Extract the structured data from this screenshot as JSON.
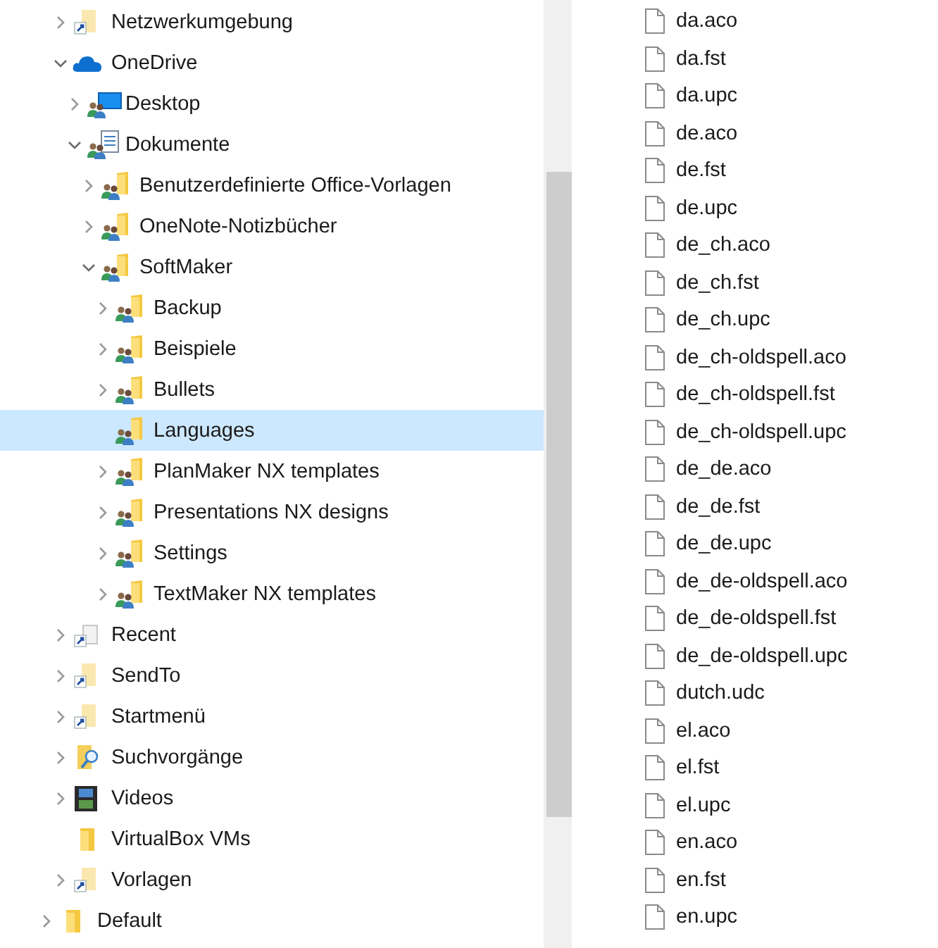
{
  "navigation_pane": {
    "items": [
      {
        "label": "Netzwerkumgebung",
        "kind": "shortcut-folder",
        "has_children": true,
        "expanded": false,
        "selected": false
      },
      {
        "label": "OneDrive",
        "kind": "cloud",
        "has_children": true,
        "expanded": true,
        "selected": false,
        "children": [
          {
            "label": "Desktop",
            "kind": "shared-desktop",
            "has_children": true,
            "expanded": false,
            "selected": false
          },
          {
            "label": "Dokumente",
            "kind": "shared-documents",
            "has_children": true,
            "expanded": true,
            "selected": false,
            "children": [
              {
                "label": "Benutzerdefinierte Office-Vorlagen",
                "kind": "shared-folder",
                "has_children": true,
                "expanded": false,
                "selected": false
              },
              {
                "label": "OneNote-Notizbücher",
                "kind": "shared-folder",
                "has_children": true,
                "expanded": false,
                "selected": false
              },
              {
                "label": "SoftMaker",
                "kind": "shared-folder",
                "has_children": true,
                "expanded": true,
                "selected": false,
                "children": [
                  {
                    "label": "Backup",
                    "kind": "shared-folder",
                    "has_children": true,
                    "expanded": false,
                    "selected": false
                  },
                  {
                    "label": "Beispiele",
                    "kind": "shared-folder",
                    "has_children": true,
                    "expanded": false,
                    "selected": false
                  },
                  {
                    "label": "Bullets",
                    "kind": "shared-folder",
                    "has_children": true,
                    "expanded": false,
                    "selected": false
                  },
                  {
                    "label": "Languages",
                    "kind": "shared-folder",
                    "has_children": false,
                    "selected": true
                  },
                  {
                    "label": "PlanMaker NX templates",
                    "kind": "shared-folder",
                    "has_children": true,
                    "expanded": false,
                    "selected": false
                  },
                  {
                    "label": "Presentations NX designs",
                    "kind": "shared-folder",
                    "has_children": true,
                    "expanded": false,
                    "selected": false
                  },
                  {
                    "label": "Settings",
                    "kind": "shared-folder",
                    "has_children": true,
                    "expanded": false,
                    "selected": false
                  },
                  {
                    "label": "TextMaker NX templates",
                    "kind": "shared-folder",
                    "has_children": true,
                    "expanded": false,
                    "selected": false
                  }
                ]
              }
            ]
          }
        ]
      },
      {
        "label": "Recent",
        "kind": "shortcut-file",
        "has_children": true,
        "expanded": false,
        "selected": false
      },
      {
        "label": "SendTo",
        "kind": "shortcut-folder",
        "has_children": true,
        "expanded": false,
        "selected": false
      },
      {
        "label": "Startmenü",
        "kind": "shortcut-folder",
        "has_children": true,
        "expanded": false,
        "selected": false
      },
      {
        "label": "Suchvorgänge",
        "kind": "search-folder",
        "has_children": true,
        "expanded": false,
        "selected": false
      },
      {
        "label": "Videos",
        "kind": "video-folder",
        "has_children": true,
        "expanded": false,
        "selected": false
      },
      {
        "label": "VirtualBox VMs",
        "kind": "folder",
        "has_children": false,
        "selected": false
      },
      {
        "label": "Vorlagen",
        "kind": "shortcut-folder",
        "has_children": true,
        "expanded": false,
        "selected": false
      }
    ],
    "following_items": [
      {
        "label": "Default",
        "kind": "folder",
        "has_children": true,
        "expanded": false,
        "selected": false
      }
    ]
  },
  "files": [
    "da.aco",
    "da.fst",
    "da.upc",
    "de.aco",
    "de.fst",
    "de.upc",
    "de_ch.aco",
    "de_ch.fst",
    "de_ch.upc",
    "de_ch-oldspell.aco",
    "de_ch-oldspell.fst",
    "de_ch-oldspell.upc",
    "de_de.aco",
    "de_de.fst",
    "de_de.upc",
    "de_de-oldspell.aco",
    "de_de-oldspell.fst",
    "de_de-oldspell.upc",
    "dutch.udc",
    "el.aco",
    "el.fst",
    "el.upc",
    "en.aco",
    "en.fst",
    "en.upc"
  ]
}
